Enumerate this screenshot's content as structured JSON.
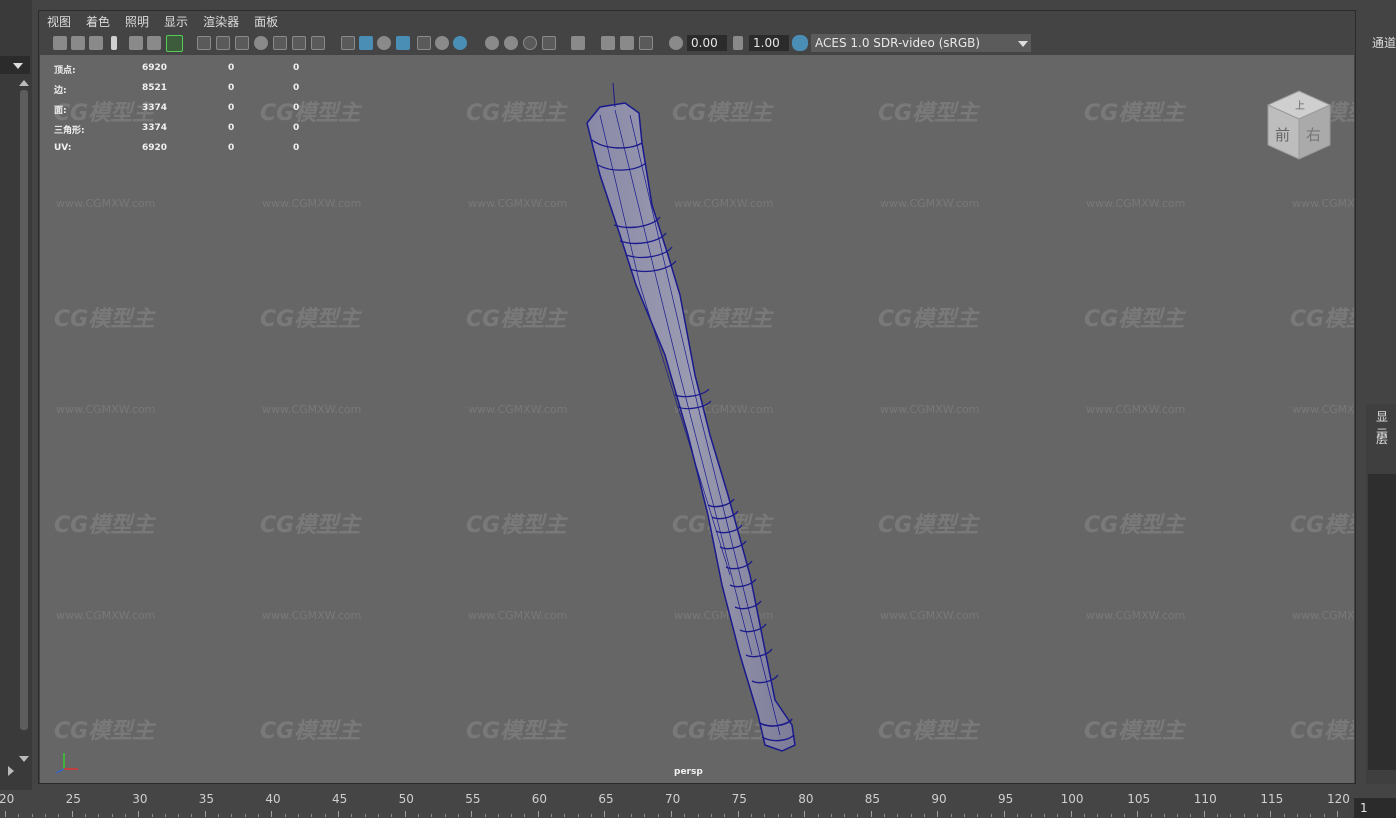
{
  "menu": [
    "视图",
    "着色",
    "照明",
    "显示",
    "渲染器",
    "面板"
  ],
  "toolbar": {
    "exposure": "0.00",
    "gamma": "1.00",
    "color_space": "ACES 1.0 SDR-video (sRGB)"
  },
  "hud": [
    {
      "label": "顶点:",
      "v1": "6920",
      "v2": "0",
      "v3": "0"
    },
    {
      "label": "边:",
      "v1": "8521",
      "v2": "0",
      "v3": "0"
    },
    {
      "label": "面:",
      "v1": "3374",
      "v2": "0",
      "v3": "0"
    },
    {
      "label": "三角形:",
      "v1": "3374",
      "v2": "0",
      "v3": "0"
    },
    {
      "label": "UV:",
      "v1": "6920",
      "v2": "0",
      "v3": "0"
    }
  ],
  "camera_label": "persp",
  "viewcube": {
    "top": "上",
    "front": "前",
    "right": "右"
  },
  "watermark": {
    "logo": "CG模型主",
    "url": "www.CGMXW.com"
  },
  "right_panel": {
    "channels": "通道",
    "display": "显示",
    "layers": "层"
  },
  "timeline": {
    "ticks": [
      "20",
      "25",
      "30",
      "35",
      "40",
      "45",
      "50",
      "55",
      "60",
      "65",
      "70",
      "75",
      "80",
      "85",
      "90",
      "95",
      "100",
      "105",
      "110",
      "115",
      "120"
    ],
    "current_frame": "1"
  },
  "colors": {
    "wireframe": "#1a1a8c",
    "viewport_bg": "#666666",
    "ui_bg": "#444444"
  }
}
